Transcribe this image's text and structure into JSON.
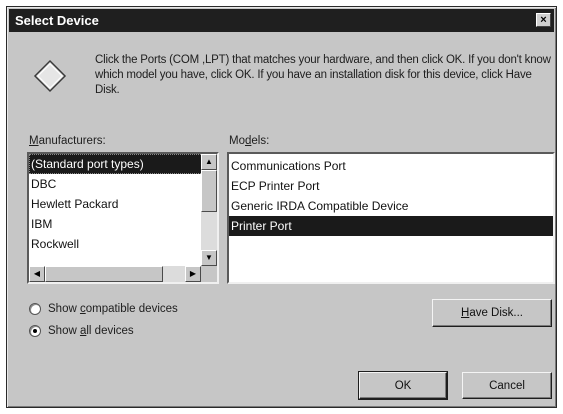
{
  "window": {
    "title": "Select Device",
    "close_glyph": "×"
  },
  "instructions": "Click the Ports (COM ,LPT) that matches your hardware, and then click OK. If you don't know which model you have, click OK. If you have an installation disk for this device, click Have Disk.",
  "manufacturers": {
    "label_mnemonic": "M",
    "label_rest": "anufacturers:",
    "items": [
      {
        "label": "(Standard port types)",
        "selected": true
      },
      {
        "label": "DBC",
        "selected": false
      },
      {
        "label": "Hewlett Packard",
        "selected": false
      },
      {
        "label": "IBM",
        "selected": false
      },
      {
        "label": "Rockwell",
        "selected": false
      }
    ]
  },
  "models": {
    "label_pre": "Mo",
    "label_mnemonic": "d",
    "label_rest": "els:",
    "items": [
      {
        "label": "Communications Port",
        "selected": false
      },
      {
        "label": "ECP Printer Port",
        "selected": false
      },
      {
        "label": "Generic IRDA Compatible Device",
        "selected": false
      },
      {
        "label": "Printer Port",
        "selected": true
      }
    ]
  },
  "radios": {
    "compatible": {
      "pre": "Show ",
      "mnemonic": "c",
      "rest": "ompatible devices",
      "checked": false
    },
    "all": {
      "pre": "Show ",
      "mnemonic": "a",
      "rest": "ll devices",
      "checked": true
    }
  },
  "buttons": {
    "have_disk": {
      "mnemonic": "H",
      "rest": "ave Disk..."
    },
    "ok": "OK",
    "cancel": "Cancel"
  },
  "icons": {
    "info": "diamond-info-icon",
    "scroll_up": "▲",
    "scroll_down": "▼",
    "scroll_left": "◀",
    "scroll_right": "▶"
  }
}
